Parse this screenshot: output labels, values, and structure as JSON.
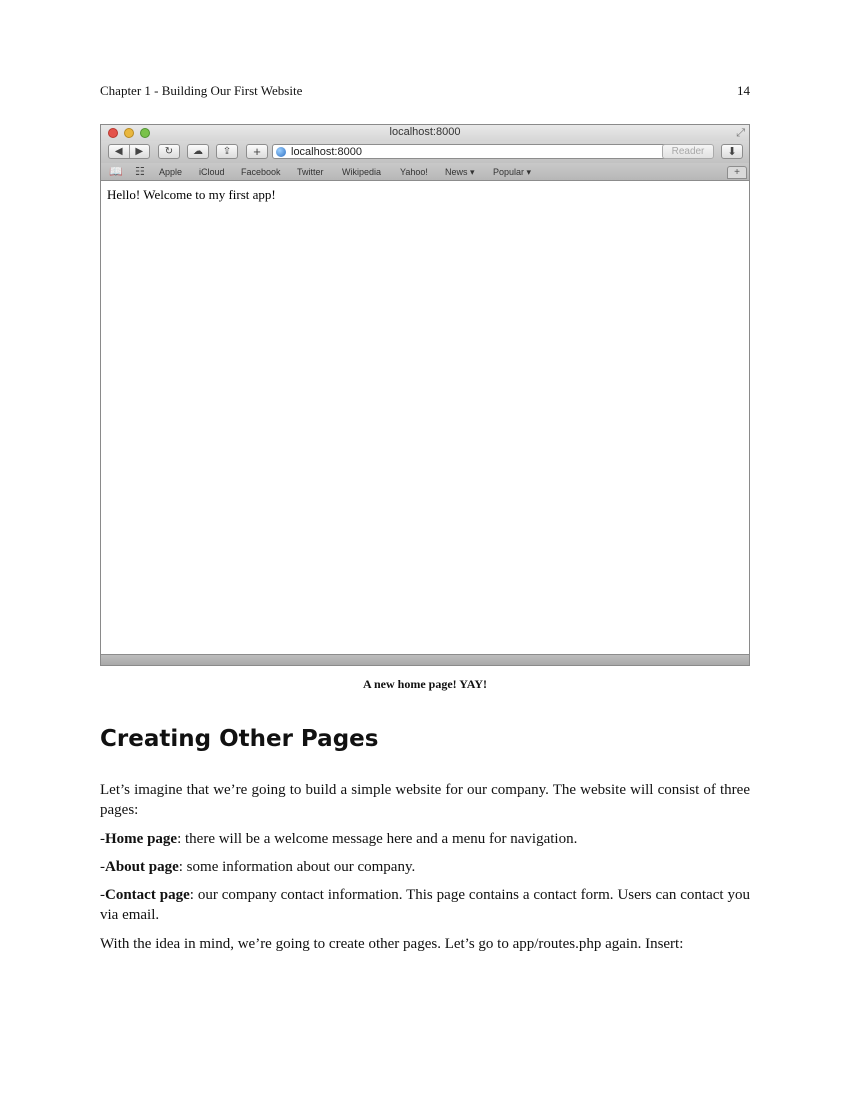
{
  "header": {
    "chapter": "Chapter 1 - Building Our First Website",
    "page_number": "14"
  },
  "browser": {
    "window_title": "localhost:8000",
    "address_url": "localhost:8000",
    "reader_label": "Reader",
    "bookmarks": [
      "Apple",
      "iCloud",
      "Facebook",
      "Twitter",
      "Wikipedia",
      "Yahoo!",
      "News ▾",
      "Popular ▾"
    ],
    "page_content": "Hello! Welcome to my first app!"
  },
  "caption": "A new home page! YAY!",
  "section": {
    "heading": "Creating Other Pages",
    "intro": "Let’s imagine that we’re going to build a simple website for our company. The website will consist of three pages:",
    "items": [
      {
        "prefix": "-",
        "label": "Home page",
        "text": ": there will be a welcome message here and a menu for navigation."
      },
      {
        "prefix": "-",
        "label": "About page",
        "text": ": some information about our company."
      },
      {
        "prefix": "-",
        "label": "Contact page",
        "text": ": our company contact information. This page contains a contact form. Users can contact you via email."
      }
    ],
    "outro": "With the idea in mind, we’re going to create other pages. Let’s go to app/routes.php again. Insert:"
  }
}
